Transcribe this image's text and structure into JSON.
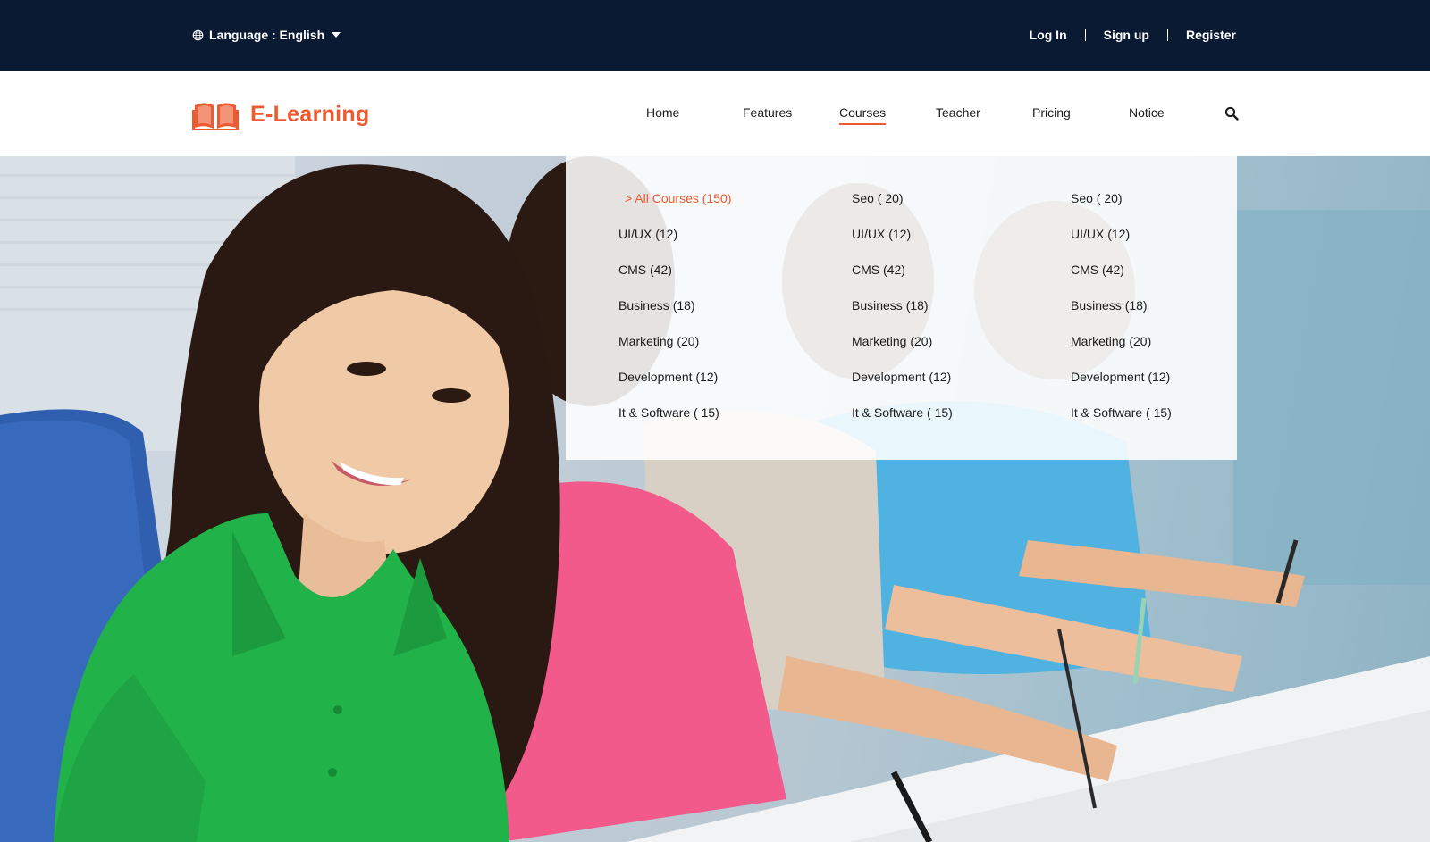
{
  "topbar": {
    "language_label": "Language : English",
    "links": [
      "Log In",
      "Sign up",
      "Register"
    ]
  },
  "logo": {
    "text": "E-Learning",
    "icon": "open-book-icon"
  },
  "nav": {
    "items": [
      "Home",
      "Features",
      "Courses",
      "Teacher",
      "Pricing",
      "Notice"
    ],
    "active": "Courses",
    "search_icon": "search-icon"
  },
  "colors": {
    "accent": "#ee5a2f",
    "topbar": "#0b1a33"
  },
  "mega_menu": {
    "columns": [
      [
        "> All Courses (150)",
        "UI/UX (12)",
        "CMS (42)",
        "Business (18)",
        "Marketing (20)",
        "Development (12)",
        "It & Software ( 15)"
      ],
      [
        "Seo ( 20)",
        "UI/UX (12)",
        "CMS (42)",
        "Business (18)",
        "Marketing (20)",
        "Development (12)",
        "It & Software ( 15)"
      ],
      [
        "Seo ( 20)",
        "UI/UX (12)",
        "CMS (42)",
        "Business (18)",
        "Marketing (20)",
        "Development (12)",
        "It & Software ( 15)"
      ]
    ]
  }
}
